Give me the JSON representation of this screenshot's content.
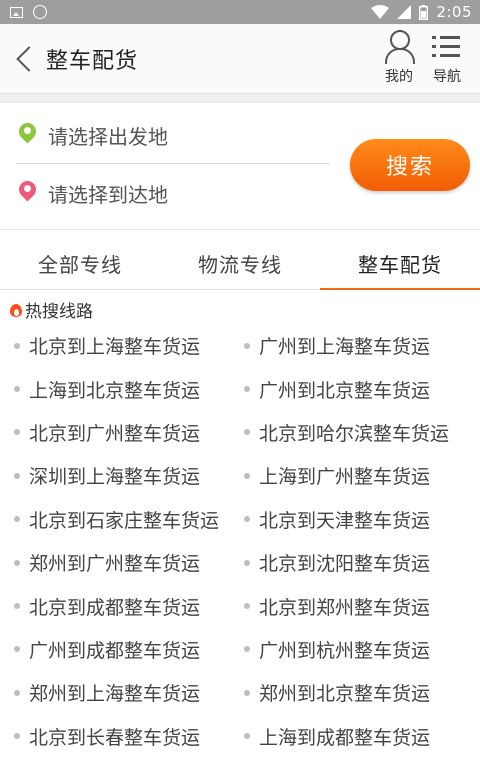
{
  "status_bar": {
    "time": "2:05"
  },
  "header": {
    "title": "整车配货",
    "mine_label": "我的",
    "nav_label": "导航"
  },
  "search": {
    "from_placeholder": "请选择出发地",
    "to_placeholder": "请选择到达地",
    "button_label": "搜索"
  },
  "tabs": [
    {
      "label": "全部专线",
      "active": false
    },
    {
      "label": "物流专线",
      "active": false
    },
    {
      "label": "整车配货",
      "active": true
    }
  ],
  "hot": {
    "title": "热搜线路",
    "routes": [
      "北京到上海整车货运",
      "广州到上海整车货运",
      "上海到北京整车货运",
      "广州到北京整车货运",
      "北京到广州整车货运",
      "北京到哈尔滨整车货运",
      "深圳到上海整车货运",
      "上海到广州整车货运",
      "北京到石家庄整车货运",
      "北京到天津整车货运",
      "郑州到广州整车货运",
      "北京到沈阳整车货运",
      "北京到成都整车货运",
      "北京到郑州整车货运",
      "广州到成都整车货运",
      "广州到杭州整车货运",
      "郑州到上海整车货运",
      "郑州到北京整车货运",
      "北京到长春整车货运",
      "上海到成都整车货运"
    ]
  },
  "colors": {
    "accent": "#f26a10",
    "search_button": "#f25c05",
    "from_pin": "#8cc63f",
    "to_pin": "#ee5a7b"
  }
}
